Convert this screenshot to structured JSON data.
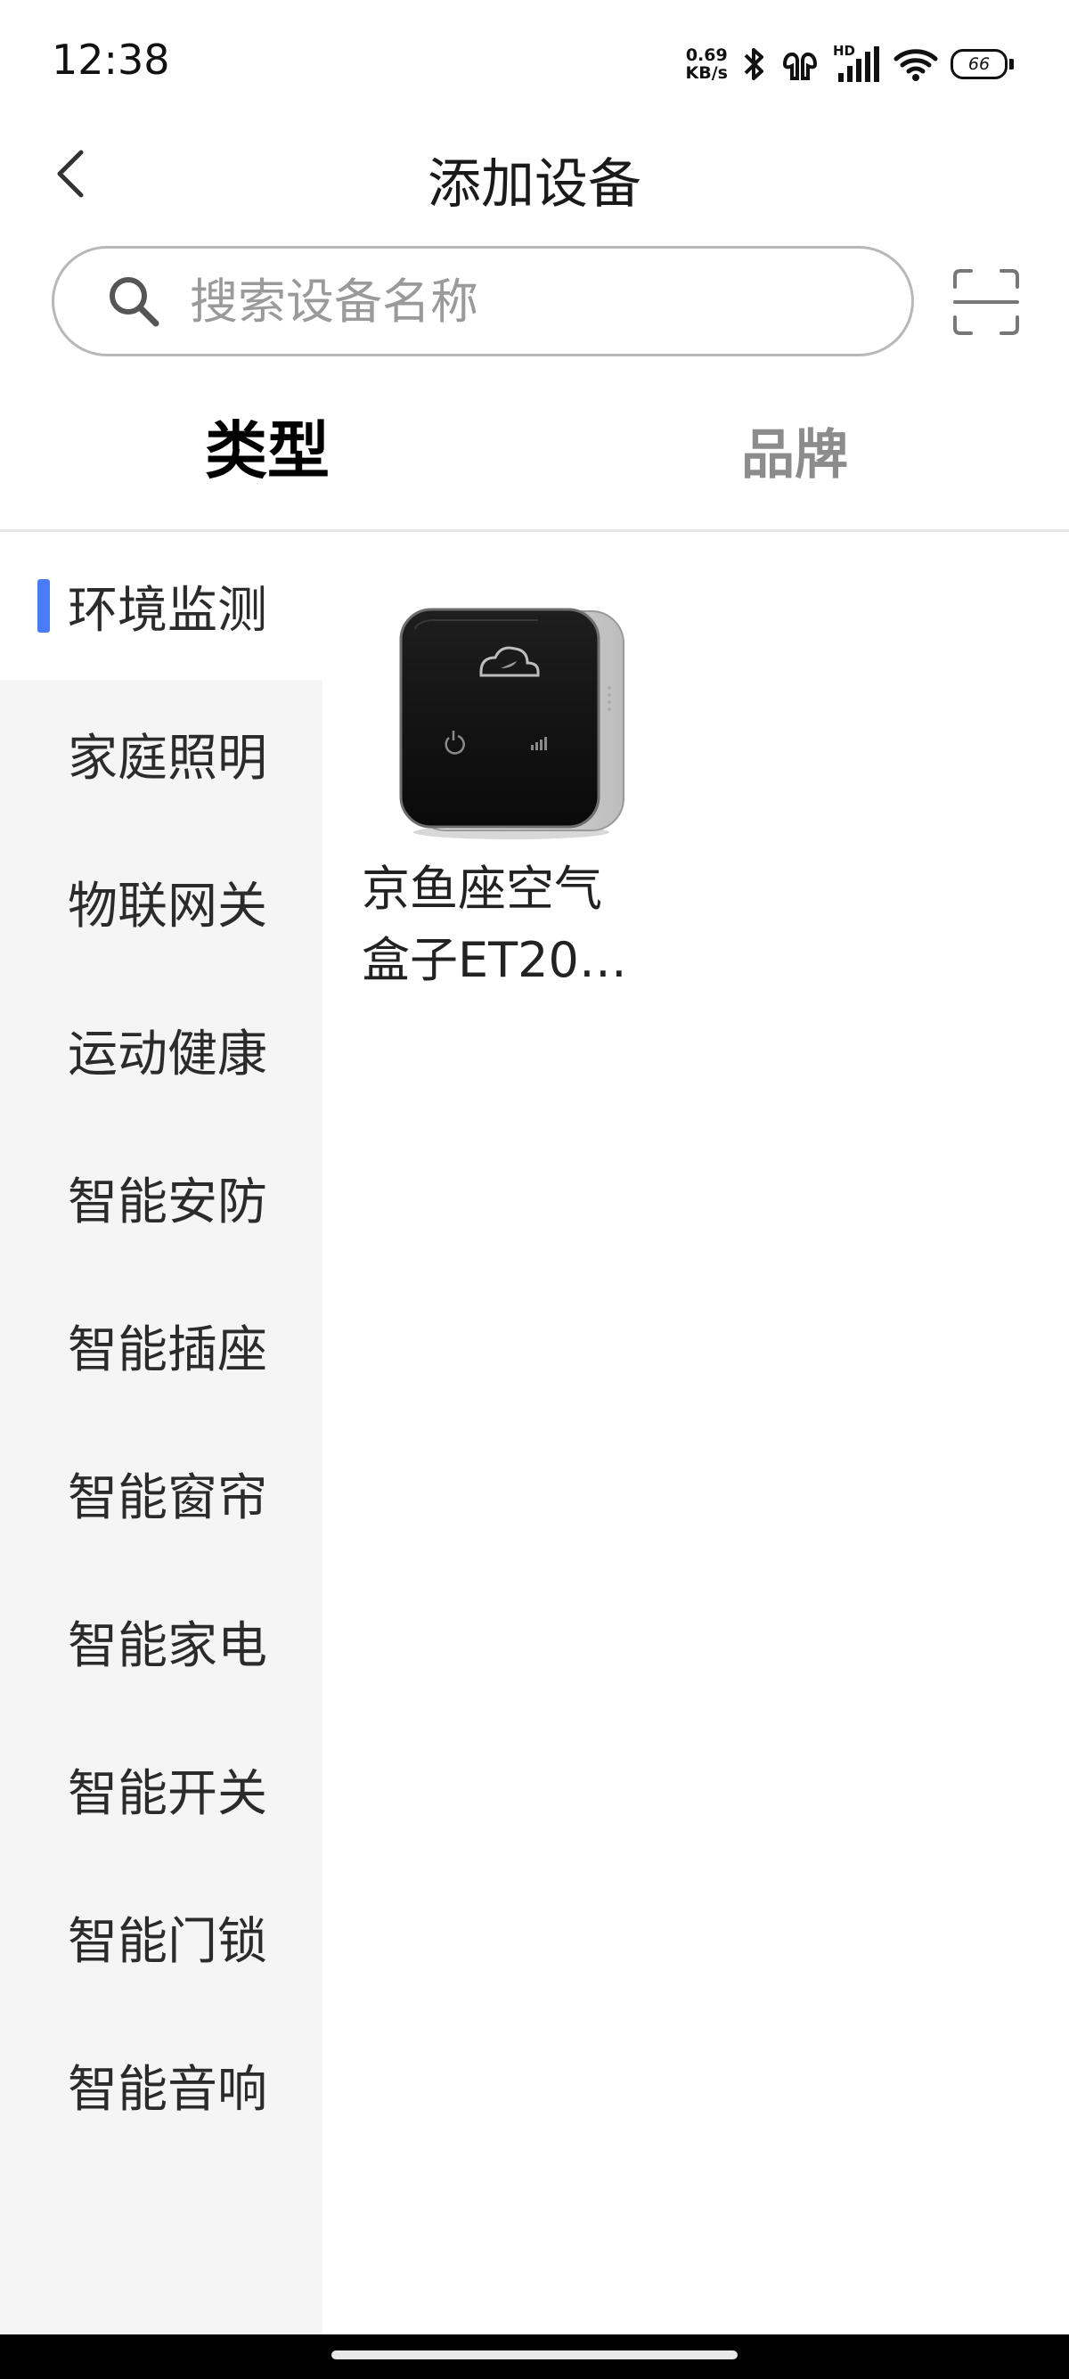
{
  "status_bar": {
    "time": "12:38",
    "net_speed_value": "0.69",
    "net_speed_unit": "KB/s",
    "signal_label": "HD",
    "battery": "66",
    "icons": [
      "bluetooth-icon",
      "earbuds-icon",
      "signal-icon",
      "wifi-icon",
      "battery-icon"
    ]
  },
  "header": {
    "title": "添加设备",
    "back_icon": "chevron-left-icon"
  },
  "search": {
    "placeholder": "搜索设备名称",
    "value": "",
    "scan_icon": "scan-icon"
  },
  "tabs": [
    {
      "label": "类型",
      "active": true
    },
    {
      "label": "品牌",
      "active": false
    }
  ],
  "sidebar": {
    "accent_color": "#4a7cf7",
    "items": [
      {
        "label": "环境监测",
        "active": true
      },
      {
        "label": "家庭照明"
      },
      {
        "label": "物联网关"
      },
      {
        "label": "运动健康"
      },
      {
        "label": "智能安防"
      },
      {
        "label": "智能插座"
      },
      {
        "label": "智能窗帘"
      },
      {
        "label": "智能家电"
      },
      {
        "label": "智能开关"
      },
      {
        "label": "智能门锁"
      },
      {
        "label": "智能音响"
      }
    ]
  },
  "devices": [
    {
      "name_line1": "京鱼座空气",
      "name_line2": "盒子ET20…",
      "image": "air-box-device"
    }
  ]
}
